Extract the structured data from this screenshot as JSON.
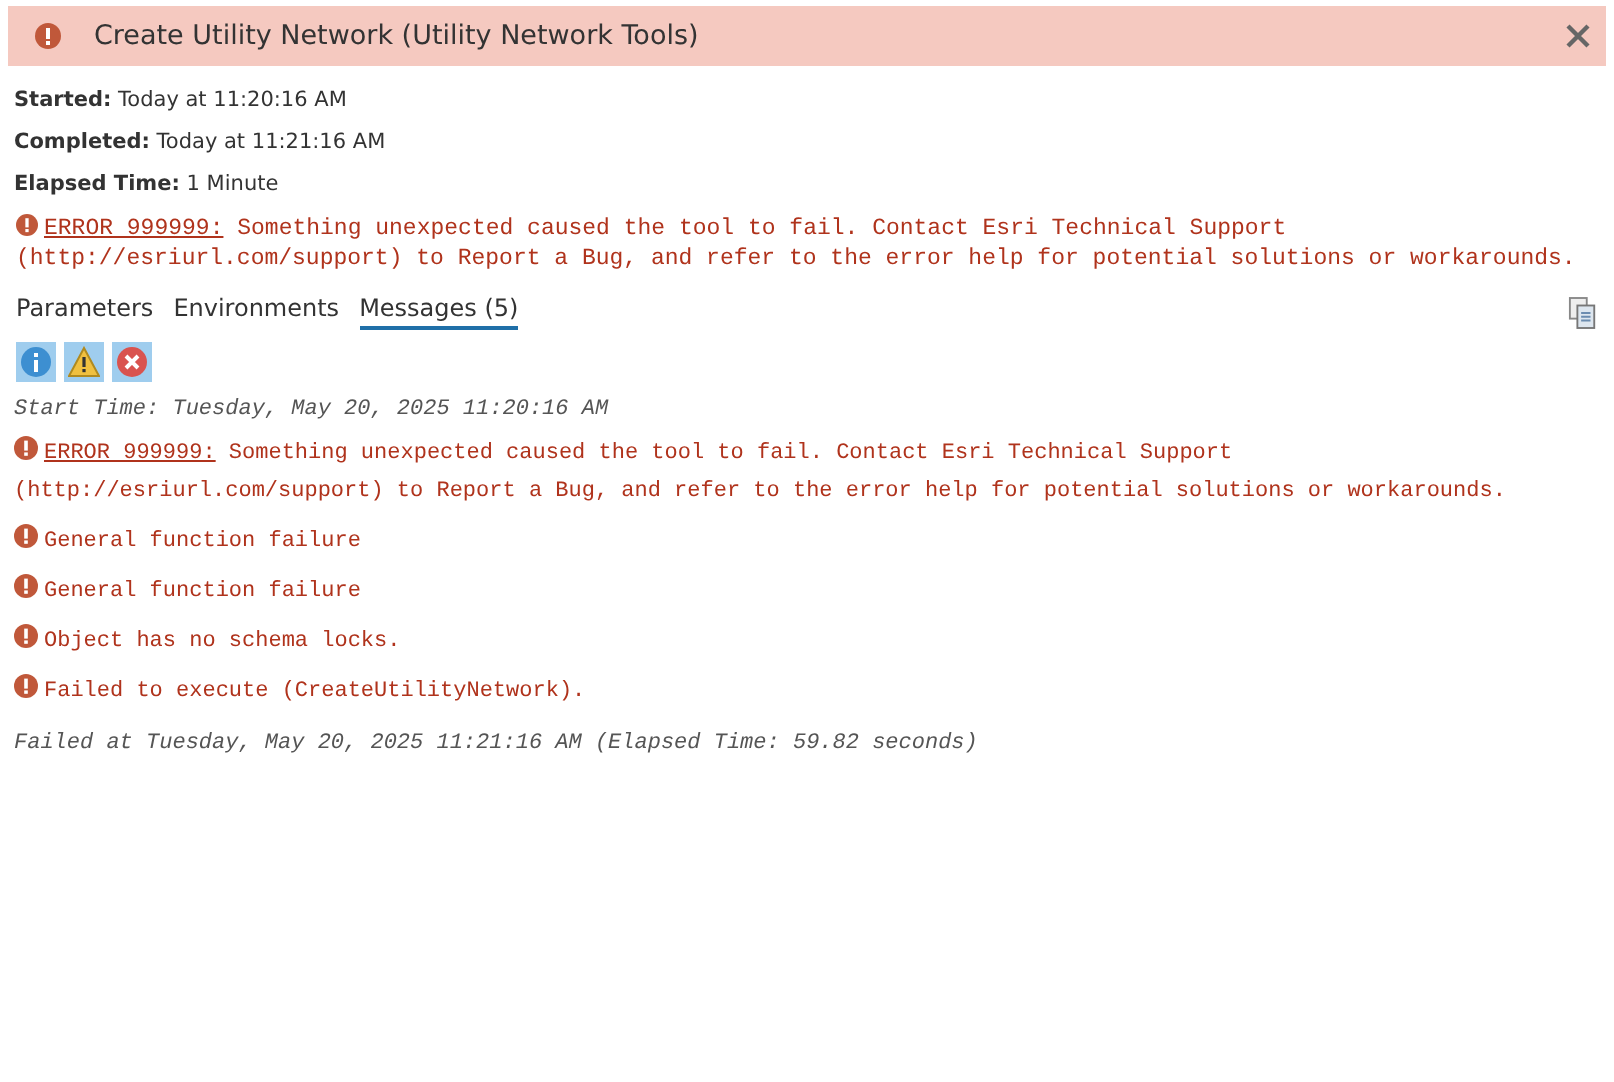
{
  "window": {
    "title": "Create Utility Network (Utility Network Tools)"
  },
  "summary": [
    {
      "label": "Started:",
      "value": "Today at 11:20:16 AM"
    },
    {
      "label": "Completed:",
      "value": "Today at 11:21:16 AM"
    },
    {
      "label": "Elapsed Time:",
      "value": "1 Minute"
    }
  ],
  "error_banner": {
    "code": "ERROR 999999:",
    "text": "Something unexpected caused the tool to fail. Contact Esri Technical Support (http://esriurl.com/support) to Report a Bug, and refer to the error help for potential solutions or workarounds."
  },
  "tabs": [
    {
      "label": "Parameters",
      "selected": false
    },
    {
      "label": "Environments",
      "selected": false
    },
    {
      "label": "Messages (5)",
      "selected": true
    }
  ],
  "filters": [
    {
      "kind": "info",
      "selected": true
    },
    {
      "kind": "warning",
      "selected": true
    },
    {
      "kind": "error",
      "selected": true
    }
  ],
  "messages": [
    {
      "kind": "info",
      "text": "Start Time: Tuesday, May 20, 2025 11:20:16 AM"
    },
    {
      "kind": "error",
      "code": "ERROR 999999:",
      "text": "Something unexpected caused the tool to fail. Contact Esri Technical Support (http://esriurl.com/support) to Report a Bug, and refer to the error help for potential solutions or workarounds."
    },
    {
      "kind": "error",
      "text": "General function failure"
    },
    {
      "kind": "error",
      "text": "General function failure"
    },
    {
      "kind": "error",
      "text": "Object has no schema locks."
    },
    {
      "kind": "error",
      "text": "Failed to execute (CreateUtilityNetwork)."
    },
    {
      "kind": "info",
      "text": "Failed at Tuesday, May 20, 2025 11:21:16 AM (Elapsed Time: 59.82 seconds)"
    }
  ]
}
